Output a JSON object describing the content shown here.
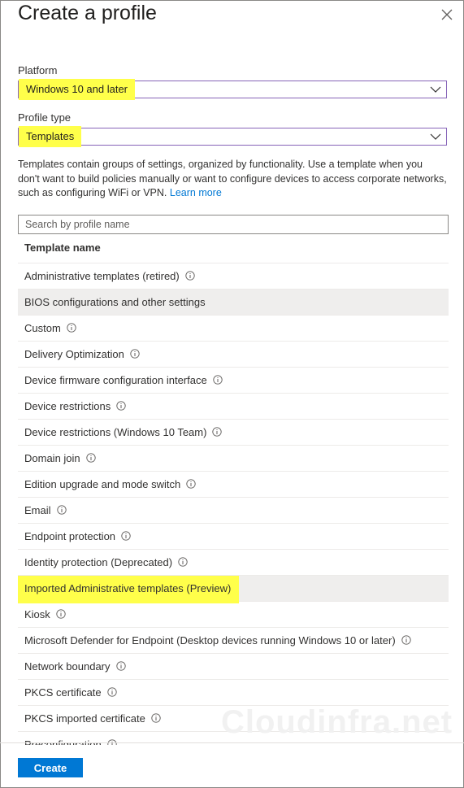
{
  "dialog": {
    "title": "Create a profile"
  },
  "platform": {
    "label": "Platform",
    "value": "Windows 10 and later"
  },
  "profile_type": {
    "label": "Profile type",
    "value": "Templates"
  },
  "description": {
    "text": "Templates contain groups of settings, organized by functionality. Use a template when you don't want to build policies manually or want to configure devices to access corporate networks, such as configuring WiFi or VPN. ",
    "link": "Learn more"
  },
  "search": {
    "placeholder": "Search by profile name",
    "value": ""
  },
  "table": {
    "column_header": "Template name",
    "rows": [
      {
        "label": "Administrative templates (retired)",
        "info": true,
        "selected": false
      },
      {
        "label": "BIOS configurations and other settings",
        "info": false,
        "selected": true
      },
      {
        "label": "Custom",
        "info": true,
        "selected": false
      },
      {
        "label": "Delivery Optimization",
        "info": true,
        "selected": false
      },
      {
        "label": "Device firmware configuration interface",
        "info": true,
        "selected": false
      },
      {
        "label": "Device restrictions",
        "info": true,
        "selected": false
      },
      {
        "label": "Device restrictions (Windows 10 Team)",
        "info": true,
        "selected": false
      },
      {
        "label": "Domain join",
        "info": true,
        "selected": false
      },
      {
        "label": "Edition upgrade and mode switch",
        "info": true,
        "selected": false
      },
      {
        "label": "Email",
        "info": true,
        "selected": false
      },
      {
        "label": "Endpoint protection",
        "info": true,
        "selected": false
      },
      {
        "label": "Identity protection (Deprecated)",
        "info": true,
        "selected": false
      },
      {
        "label": "Imported Administrative templates (Preview)",
        "info": false,
        "selected": true,
        "highlighted": true
      },
      {
        "label": "Kiosk",
        "info": true,
        "selected": false
      },
      {
        "label": "Microsoft Defender for Endpoint (Desktop devices running Windows 10 or later)",
        "info": true,
        "selected": false
      },
      {
        "label": "Network boundary",
        "info": true,
        "selected": false
      },
      {
        "label": "PKCS certificate",
        "info": true,
        "selected": false
      },
      {
        "label": "PKCS imported certificate",
        "info": true,
        "selected": false
      },
      {
        "label": "Preconfiguration",
        "info": true,
        "selected": false
      }
    ]
  },
  "footer": {
    "create_label": "Create"
  },
  "watermark": "Cloudinfra.net",
  "colors": {
    "accent": "#0078d4",
    "highlight": "#ffff4a",
    "select_border": "#8764b8",
    "selected_row": "#efeeed"
  },
  "icons": {
    "close": "close-icon",
    "chevron": "chevron-down-icon",
    "info": "info-icon"
  }
}
